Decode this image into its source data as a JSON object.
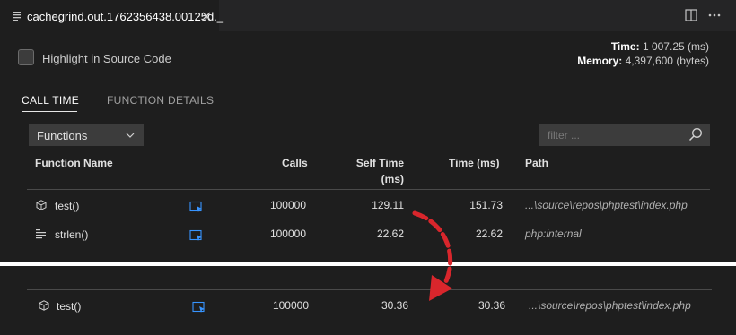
{
  "tab": {
    "title": "cachegrind.out.1762356438.00125d._",
    "icon": "file-lines-icon",
    "close_icon": "close-icon"
  },
  "editor_actions": {
    "split_icon": "split-editor-icon",
    "more_icon": "more-actions-icon"
  },
  "options": {
    "highlight_label": "Highlight in Source Code",
    "highlight_checked": false
  },
  "stats": {
    "time_label": "Time:",
    "time_value": "1 007.25 (ms)",
    "memory_label": "Memory:",
    "memory_value": "4,397,600 (bytes)"
  },
  "view_tabs": [
    {
      "label": "CALL TIME",
      "active": true
    },
    {
      "label": "FUNCTION DETAILS",
      "active": false
    }
  ],
  "dropdown": {
    "selected": "Functions"
  },
  "filter": {
    "placeholder": "filter ..."
  },
  "table": {
    "columns": {
      "name": "Function Name",
      "calls": "Calls",
      "self_time_1": "Self Time",
      "self_time_2": "(ms)",
      "time": "Time (ms)",
      "path": "Path"
    },
    "rows": [
      {
        "icon": "cube-icon",
        "name": "test()",
        "calls": "100000",
        "self_time": "129.11",
        "time": "151.73",
        "path": "...\\source\\repos\\phptest\\index.php"
      },
      {
        "icon": "list-icon",
        "name": "strlen()",
        "calls": "100000",
        "self_time": "22.62",
        "time": "22.62",
        "path": "php:internal"
      }
    ]
  },
  "comparison_row": {
    "icon": "cube-icon",
    "name": "test()",
    "calls": "100000",
    "self_time": "30.36",
    "time": "30.36",
    "path": "...\\source\\repos\\phptest\\index.php"
  },
  "colors": {
    "accent_arrow": "#d9262c",
    "link_icon": "#3794ff",
    "background": "#1e1e1e"
  }
}
